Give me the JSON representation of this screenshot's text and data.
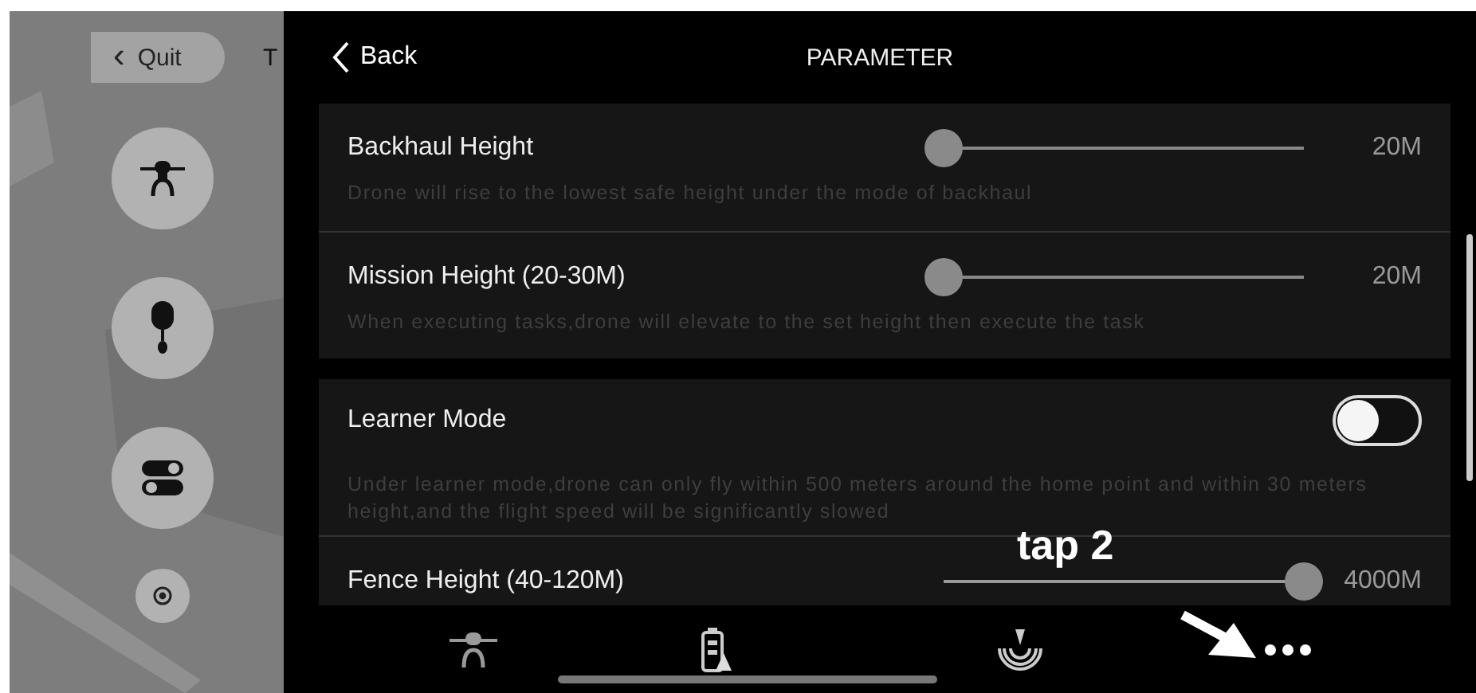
{
  "map_panel": {
    "quit_button": {
      "icon": "‹",
      "label": "Quit"
    },
    "cut_text": "T",
    "buttons": [
      {
        "kind": "drone"
      },
      {
        "kind": "remote"
      },
      {
        "kind": "switches"
      },
      {
        "kind": "locate"
      }
    ]
  },
  "header": {
    "back": "Back",
    "title": "PARAMETER"
  },
  "groups": [
    {
      "rows": [
        {
          "kind": "slider",
          "title": "Backhaul Height",
          "description": "Drone will rise to the lowest safe height under the mode of backhaul",
          "level": 0,
          "reading": "20M"
        },
        {
          "kind": "slider",
          "title": "Mission Height (20-30M)",
          "description": "When executing tasks,drone will elevate to the set height then execute the task",
          "level": 0,
          "reading": "20M"
        }
      ]
    },
    {
      "rows": [
        {
          "kind": "toggle",
          "title": "Learner Mode",
          "description": "Under learner mode,drone can only fly within 500 meters around the home point and within 30 meters height,and the flight speed will be significantly slowed",
          "on": false
        },
        {
          "kind": "slider",
          "title": "Fence Height (40-120M)",
          "level": 1,
          "reading": "4000M"
        }
      ]
    }
  ],
  "nav": [
    {
      "kind": "drone"
    },
    {
      "kind": "battery"
    },
    {
      "kind": "signal"
    },
    {
      "kind": "more"
    }
  ],
  "annotation": {
    "text": "tap 2"
  }
}
